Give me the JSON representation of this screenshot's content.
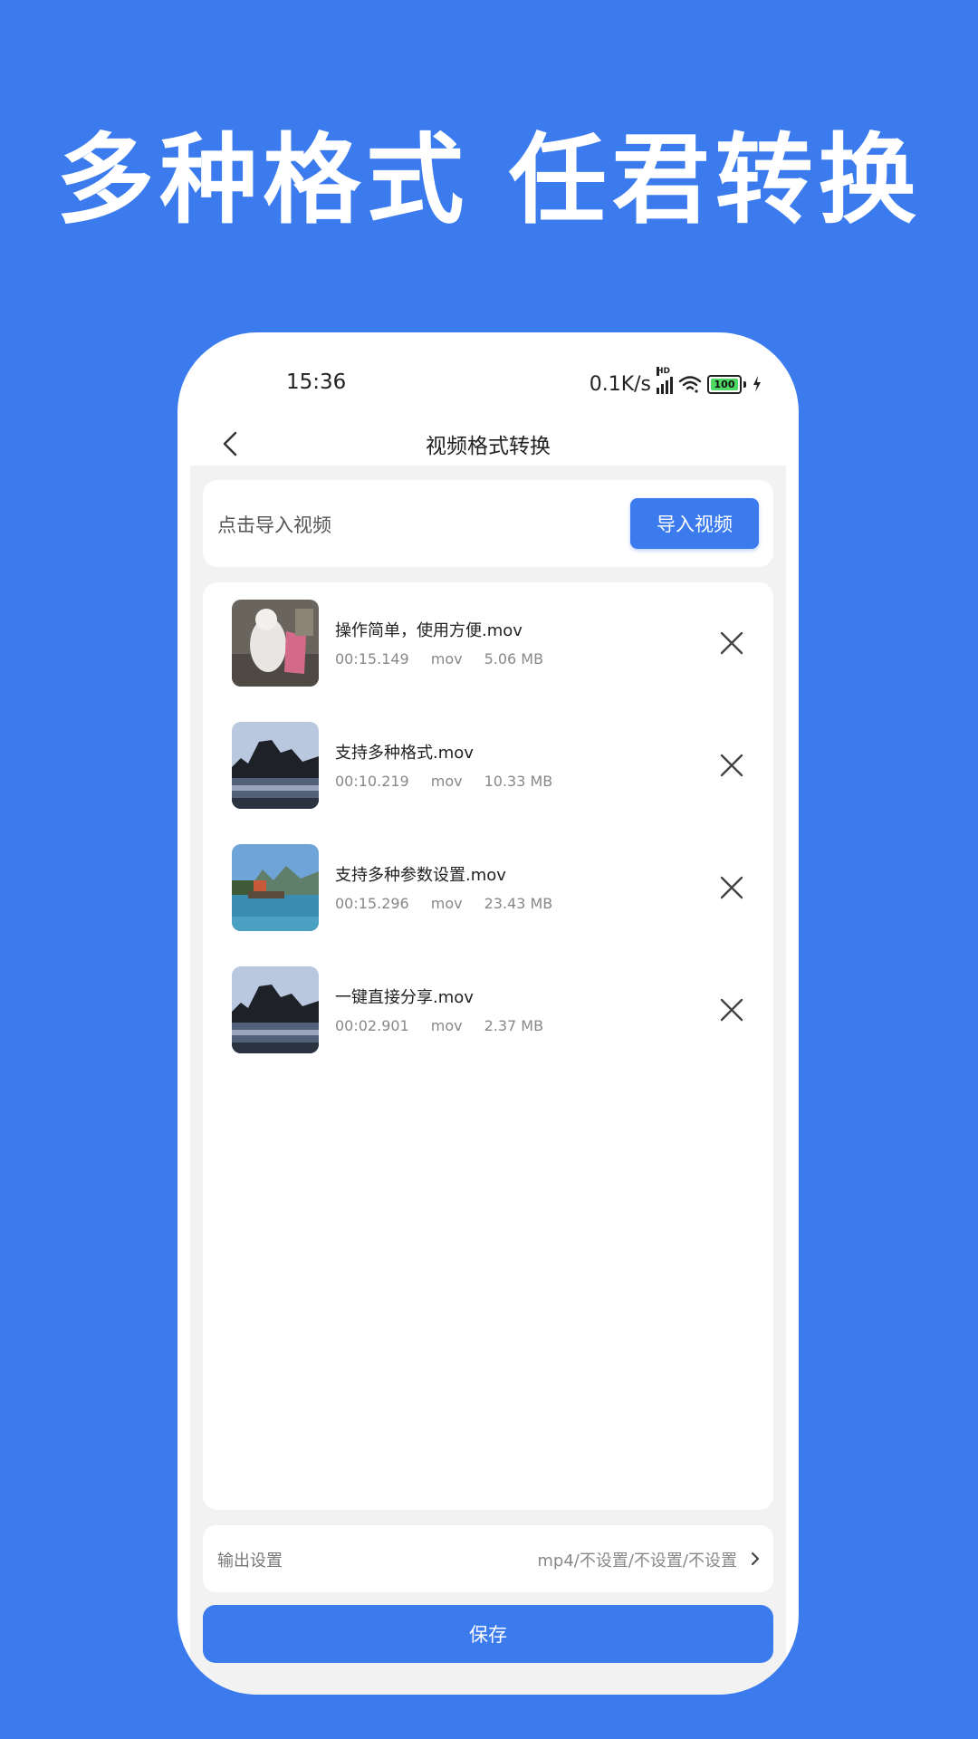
{
  "headline": "多种格式 任君转换",
  "status_bar": {
    "time": "15:36",
    "network_speed": "0.1K/s",
    "signal_badge": "HD",
    "battery_level": "100",
    "icons": [
      "signal-icon",
      "wifi-icon",
      "battery-icon",
      "charging-icon"
    ]
  },
  "nav": {
    "title": "视频格式转换",
    "back_icon": "chevron-left-icon"
  },
  "import": {
    "hint": "点击导入视频",
    "button_label": "导入视频"
  },
  "videos": [
    {
      "name": "操作简单，使用方便.mov",
      "duration": "00:15.149",
      "format": "mov",
      "size": "5.06 MB",
      "thumbnail": "cat-photo"
    },
    {
      "name": "支持多种格式.mov",
      "duration": "00:10.219",
      "format": "mov",
      "size": "10.33 MB",
      "thumbnail": "river-dusk-photo"
    },
    {
      "name": "支持多种参数设置.mov",
      "duration": "00:15.296",
      "format": "mov",
      "size": "23.43 MB",
      "thumbnail": "river-boat-photo"
    },
    {
      "name": "一键直接分享.mov",
      "duration": "00:02.901",
      "format": "mov",
      "size": "2.37 MB",
      "thumbnail": "river-dusk-photo"
    }
  ],
  "output": {
    "label": "输出设置",
    "value": "mp4/不设置/不设置/不设置"
  },
  "save_label": "保存",
  "colors": {
    "brand_blue": "#3b7bee",
    "page_grey": "#f2f2f2",
    "battery_green": "#4cd964"
  }
}
